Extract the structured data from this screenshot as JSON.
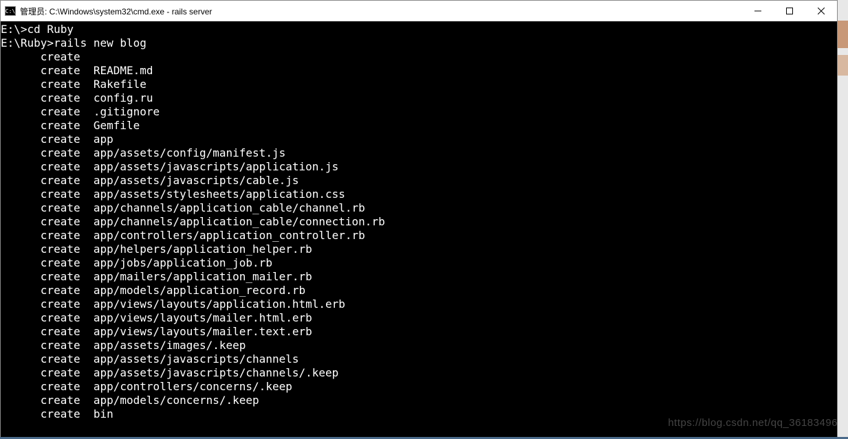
{
  "window": {
    "title": "管理员: C:\\Windows\\system32\\cmd.exe - rails  server",
    "icon_text": "C:\\"
  },
  "terminal": {
    "lines": [
      "E:\\>cd Ruby",
      "",
      "E:\\Ruby>rails new blog",
      "      create",
      "      create  README.md",
      "      create  Rakefile",
      "      create  config.ru",
      "      create  .gitignore",
      "      create  Gemfile",
      "      create  app",
      "      create  app/assets/config/manifest.js",
      "      create  app/assets/javascripts/application.js",
      "      create  app/assets/javascripts/cable.js",
      "      create  app/assets/stylesheets/application.css",
      "      create  app/channels/application_cable/channel.rb",
      "      create  app/channels/application_cable/connection.rb",
      "      create  app/controllers/application_controller.rb",
      "      create  app/helpers/application_helper.rb",
      "      create  app/jobs/application_job.rb",
      "      create  app/mailers/application_mailer.rb",
      "      create  app/models/application_record.rb",
      "      create  app/views/layouts/application.html.erb",
      "      create  app/views/layouts/mailer.html.erb",
      "      create  app/views/layouts/mailer.text.erb",
      "      create  app/assets/images/.keep",
      "      create  app/assets/javascripts/channels",
      "      create  app/assets/javascripts/channels/.keep",
      "      create  app/controllers/concerns/.keep",
      "      create  app/models/concerns/.keep",
      "      create  bin"
    ]
  },
  "watermark": "https://blog.csdn.net/qq_36183496"
}
